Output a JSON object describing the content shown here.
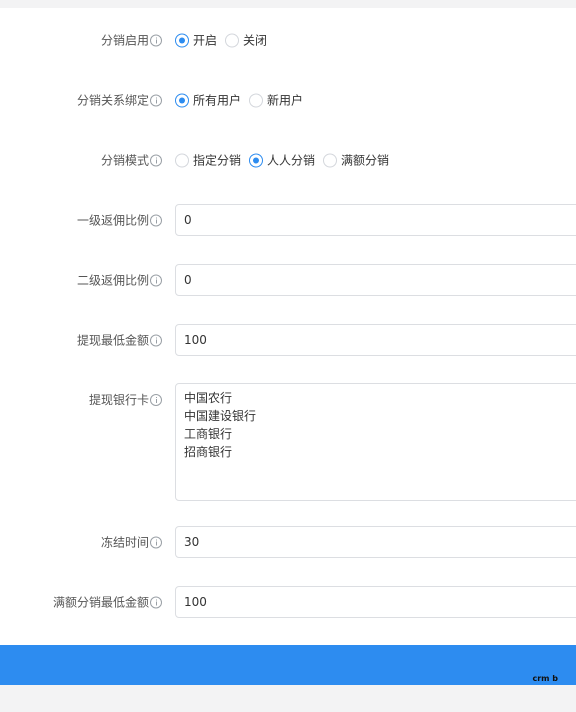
{
  "form": {
    "distribution_enabled": {
      "label": "分销启用",
      "options": [
        "开启",
        "关闭"
      ],
      "selected": 0
    },
    "relation_binding": {
      "label": "分销关系绑定",
      "options": [
        "所有用户",
        "新用户"
      ],
      "selected": 0
    },
    "distribution_mode": {
      "label": "分销模式",
      "options": [
        "指定分销",
        "人人分销",
        "满额分销"
      ],
      "selected": 1
    },
    "level1_ratio": {
      "label": "一级返佣比例",
      "value": "0"
    },
    "level2_ratio": {
      "label": "二级返佣比例",
      "value": "0"
    },
    "min_withdraw": {
      "label": "提现最低金额",
      "value": "100"
    },
    "bank_cards": {
      "label": "提现银行卡",
      "value": "中国农行\n中国建设银行\n工商银行\n招商银行"
    },
    "freeze_time": {
      "label": "冻结时间",
      "value": "30"
    },
    "full_amount_min": {
      "label": "满额分销最低金额",
      "value": "100"
    }
  },
  "footer": {
    "mark": "crm b"
  },
  "colors": {
    "accent": "#2d8cf0",
    "border": "#dcdee2"
  },
  "icons": {
    "info": "info-circle-icon"
  }
}
